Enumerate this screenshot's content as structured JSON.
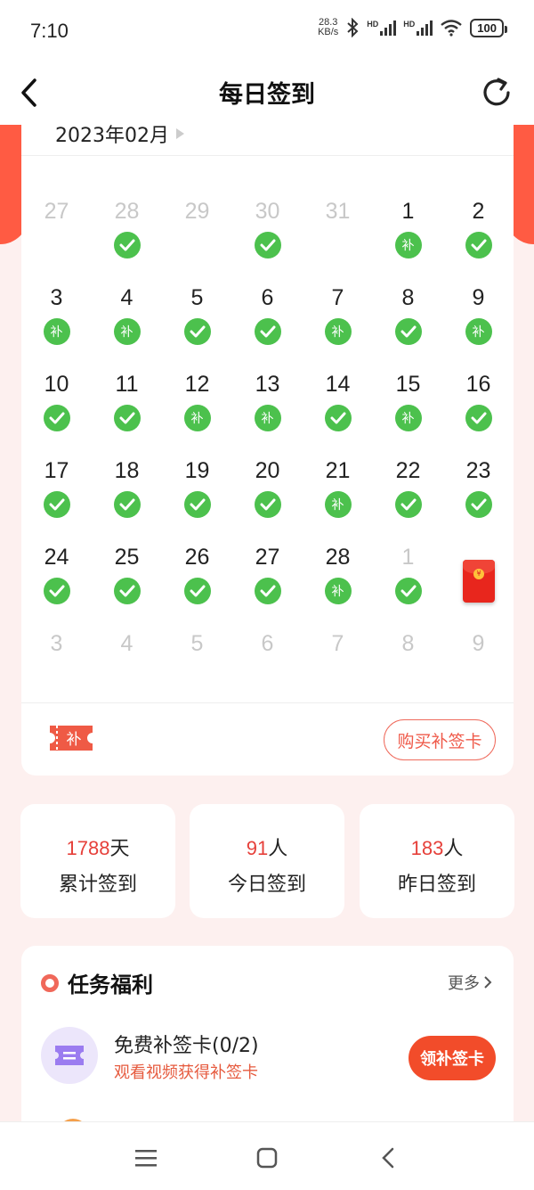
{
  "status_bar": {
    "time": "7:10",
    "net_speed_value": "28.3",
    "net_speed_unit": "KB/s",
    "signal_label_1": "HD",
    "signal_label_2": "HD",
    "battery": "100",
    "icons": [
      "bluetooth-icon",
      "signal-icon",
      "signal-icon",
      "wifi-icon",
      "battery-icon"
    ]
  },
  "header": {
    "title": "每日签到",
    "back_icon": "back-arrow-icon",
    "refresh_icon": "refresh-icon"
  },
  "calendar": {
    "month_label": "2023年02月",
    "weeks": [
      [
        {
          "day": "27",
          "other": true,
          "mark": ""
        },
        {
          "day": "28",
          "other": true,
          "mark": "check"
        },
        {
          "day": "29",
          "other": true,
          "mark": ""
        },
        {
          "day": "30",
          "other": true,
          "mark": "check"
        },
        {
          "day": "31",
          "other": true,
          "mark": ""
        },
        {
          "day": "1",
          "other": false,
          "mark": "bu"
        },
        {
          "day": "2",
          "other": false,
          "mark": "check"
        }
      ],
      [
        {
          "day": "3",
          "other": false,
          "mark": "bu"
        },
        {
          "day": "4",
          "other": false,
          "mark": "bu"
        },
        {
          "day": "5",
          "other": false,
          "mark": "check"
        },
        {
          "day": "6",
          "other": false,
          "mark": "check"
        },
        {
          "day": "7",
          "other": false,
          "mark": "bu"
        },
        {
          "day": "8",
          "other": false,
          "mark": "check"
        },
        {
          "day": "9",
          "other": false,
          "mark": "bu"
        }
      ],
      [
        {
          "day": "10",
          "other": false,
          "mark": "check"
        },
        {
          "day": "11",
          "other": false,
          "mark": "check"
        },
        {
          "day": "12",
          "other": false,
          "mark": "bu"
        },
        {
          "day": "13",
          "other": false,
          "mark": "bu"
        },
        {
          "day": "14",
          "other": false,
          "mark": "check"
        },
        {
          "day": "15",
          "other": false,
          "mark": "bu"
        },
        {
          "day": "16",
          "other": false,
          "mark": "check"
        }
      ],
      [
        {
          "day": "17",
          "other": false,
          "mark": "check"
        },
        {
          "day": "18",
          "other": false,
          "mark": "check"
        },
        {
          "day": "19",
          "other": false,
          "mark": "check"
        },
        {
          "day": "20",
          "other": false,
          "mark": "check"
        },
        {
          "day": "21",
          "other": false,
          "mark": "bu"
        },
        {
          "day": "22",
          "other": false,
          "mark": "check"
        },
        {
          "day": "23",
          "other": false,
          "mark": "check"
        }
      ],
      [
        {
          "day": "24",
          "other": false,
          "mark": "check"
        },
        {
          "day": "25",
          "other": false,
          "mark": "check"
        },
        {
          "day": "26",
          "other": false,
          "mark": "check"
        },
        {
          "day": "27",
          "other": false,
          "mark": "check"
        },
        {
          "day": "28",
          "other": false,
          "mark": "bu"
        },
        {
          "day": "1",
          "other": true,
          "mark": "check"
        },
        {
          "day": "",
          "other": true,
          "mark": "redpacket"
        }
      ],
      [
        {
          "day": "3",
          "other": true,
          "mark": ""
        },
        {
          "day": "4",
          "other": true,
          "mark": ""
        },
        {
          "day": "5",
          "other": true,
          "mark": ""
        },
        {
          "day": "6",
          "other": true,
          "mark": ""
        },
        {
          "day": "7",
          "other": true,
          "mark": ""
        },
        {
          "day": "8",
          "other": true,
          "mark": ""
        },
        {
          "day": "9",
          "other": true,
          "mark": ""
        }
      ]
    ],
    "bu_label": "补",
    "ticket_label": "补",
    "buy_button": "购买补签卡",
    "redpacket_coin": "¥"
  },
  "stats": [
    {
      "value": "1788",
      "unit": "天",
      "label": "累计签到"
    },
    {
      "value": "91",
      "unit": "人",
      "label": "今日签到"
    },
    {
      "value": "183",
      "unit": "人",
      "label": "昨日签到"
    }
  ],
  "tasks": {
    "title": "任务福利",
    "more": "更多",
    "items": [
      {
        "name": "免费补签卡(0/2)",
        "desc": "观看视频获得补签卡",
        "button": "领补签卡",
        "icon": "ticket-card-icon"
      }
    ]
  },
  "nav": {
    "buttons": [
      "menu-icon",
      "home-icon",
      "back-icon"
    ]
  },
  "colors": {
    "accent": "#f24c2a",
    "check_green": "#4cc14d",
    "stat_number": "#e6403a",
    "page_bg": "#fdf0ef"
  }
}
